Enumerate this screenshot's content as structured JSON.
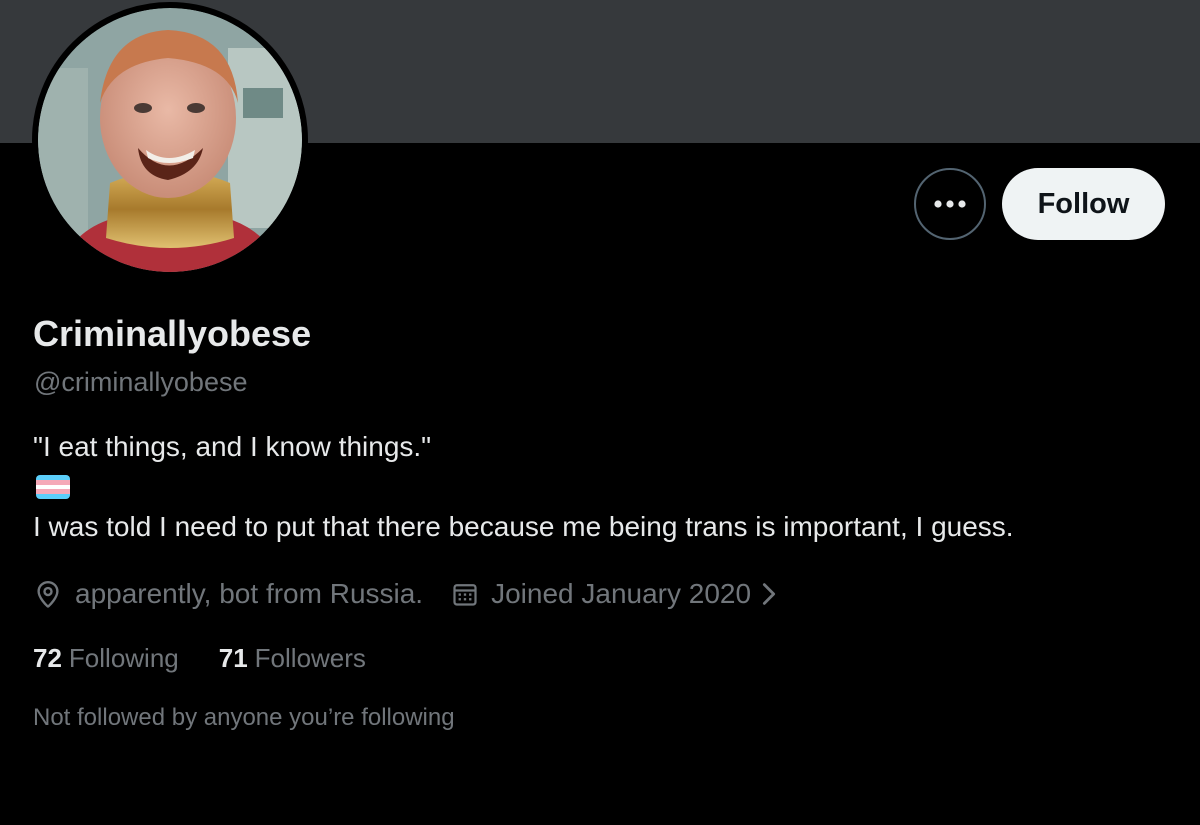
{
  "profile": {
    "display_name": "Criminallyobese",
    "handle": "@criminallyobese",
    "bio": {
      "line1": "\"I eat things, and I know things.\"",
      "flag_icon": "transgender-flag-emoji",
      "line2": "I was told I need to put that there because me being trans is important, I guess."
    },
    "location": "apparently, bot from Russia.",
    "joined": "Joined January 2020",
    "following_count": "72",
    "following_label": "Following",
    "followers_count": "71",
    "followers_label": "Followers",
    "mutuals_text": "Not followed by anyone you’re following"
  },
  "actions": {
    "more_icon": "more-horizontal-icon",
    "follow_label": "Follow"
  },
  "icons": {
    "location": "location-pin-icon",
    "calendar": "calendar-icon",
    "chevron": "chevron-right-icon"
  },
  "colors": {
    "background": "#000000",
    "banner": "#36393c",
    "primary_text": "#e7e9ea",
    "secondary_text": "#71767b",
    "follow_button_bg": "#eff3f4",
    "follow_button_text": "#0f1419",
    "flag_blue": "#5BCEFA",
    "flag_pink": "#F5A9B8",
    "flag_white": "#FFFFFF"
  }
}
